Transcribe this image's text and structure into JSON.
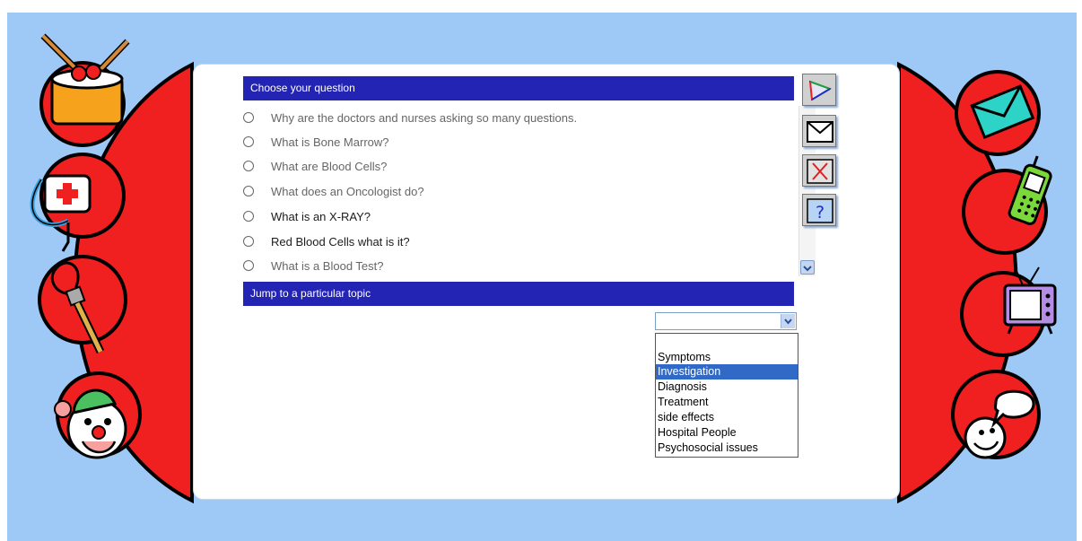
{
  "colors": {
    "background": "#9ec9f6",
    "header": "#2323b4",
    "red": "#f02020",
    "selected": "#3169c6"
  },
  "question_section": {
    "header": "Choose your question",
    "questions": [
      "Why are the doctors and nurses asking so many questions.",
      "What is Bone Marrow?",
      "What are Blood Cells?",
      "What does an Oncologist do?",
      "What is an X-RAY?",
      "Red Blood Cells what is it?",
      "What is a Blood Test?"
    ]
  },
  "topic_section": {
    "header": "Jump to a particular topic",
    "selected_value": "",
    "options": [
      "Symptoms",
      "Investigation",
      "Diagnosis",
      "Treatment",
      "side effects",
      "Hospital People",
      "Psychosocial issues"
    ],
    "highlighted_option": "Investigation"
  },
  "toolbar": {
    "icons": [
      "compass-icon",
      "email-icon",
      "close-icon",
      "help-icon"
    ],
    "help_label": "?"
  },
  "decorations": {
    "left": [
      "drum-icon",
      "nurse-kit-icon",
      "paintbrush-icon",
      "clown-icon"
    ],
    "right": [
      "envelope-icon",
      "phone-icon",
      "tv-icon",
      "chat-face-icon"
    ]
  }
}
